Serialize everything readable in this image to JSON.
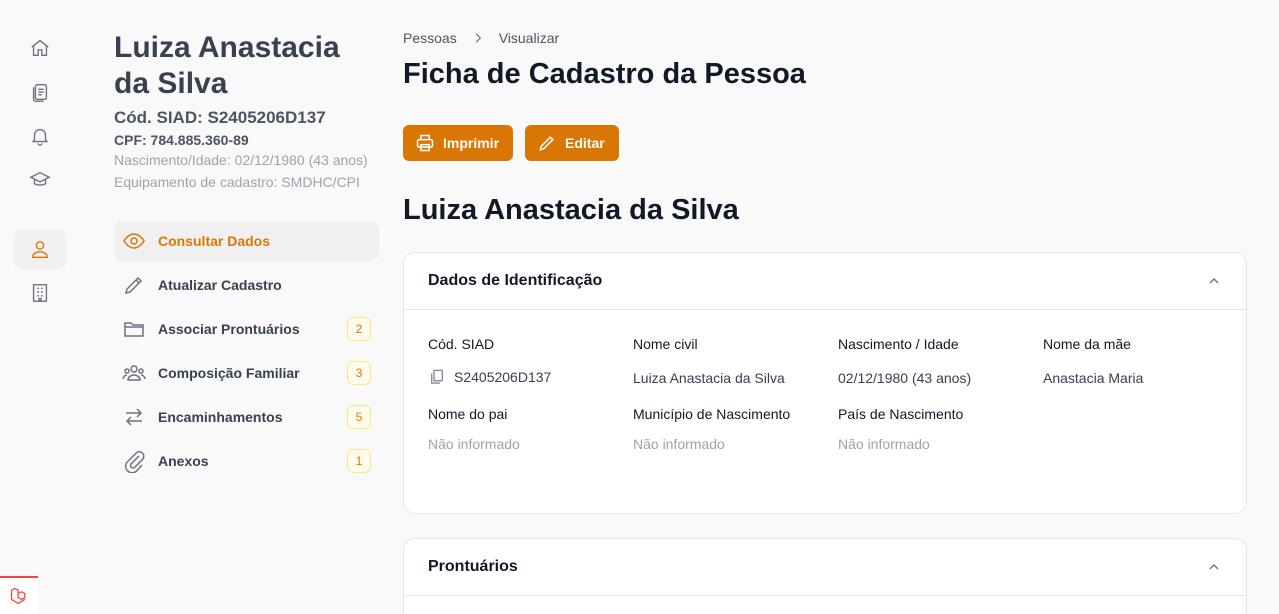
{
  "profile": {
    "name": "Luiza Anastacia da Silva",
    "siad": "Cód. SIAD: S2405206D137",
    "cpf": "CPF: 784.885.360-89",
    "birth": "Nascimento/Idade: 02/12/1980 (43 anos)",
    "equipment": "Equipamento de cadastro: SMDHC/CPI"
  },
  "rail": {
    "items": [
      "home-icon",
      "clipboard-icon",
      "bell-icon",
      "graduation-cap-icon",
      "user-icon",
      "building-icon"
    ],
    "active": "user-icon"
  },
  "menu": {
    "items": [
      {
        "label": "Consultar Dados",
        "icon": "eye-icon",
        "badge": ""
      },
      {
        "label": "Atualizar Cadastro",
        "icon": "pencil-icon",
        "badge": ""
      },
      {
        "label": "Associar Prontuários",
        "icon": "folder-icon",
        "badge": "2"
      },
      {
        "label": "Composição Familiar",
        "icon": "users-icon",
        "badge": "3"
      },
      {
        "label": "Encaminhamentos",
        "icon": "arrows-icon",
        "badge": "5"
      },
      {
        "label": "Anexos",
        "icon": "paperclip-icon",
        "badge": "1"
      }
    ]
  },
  "breadcrumb": {
    "items": [
      "Pessoas",
      "Visualizar"
    ]
  },
  "page": {
    "title": "Ficha de Cadastro da Pessoa",
    "print_label": "Imprimir",
    "edit_label": "Editar",
    "person_heading": "Luiza Anastacia da Silva"
  },
  "identification": {
    "title": "Dados de Identificação",
    "fields": [
      {
        "label": "Cód. SIAD",
        "value": "S2405206D137"
      },
      {
        "label": "Nome civil",
        "value": "Luiza Anastacia da Silva"
      },
      {
        "label": "Nascimento / Idade",
        "value": "02/12/1980 (43 anos)"
      },
      {
        "label": "Nome da mãe",
        "value": "Anastacia Maria"
      },
      {
        "label": "Nome do pai",
        "value": "Não informado"
      },
      {
        "label": "Município de Nascimento",
        "value": "Não informado"
      },
      {
        "label": "País de Nascimento",
        "value": "Não informado"
      }
    ]
  },
  "records": {
    "title": "Prontuários"
  },
  "colors": {
    "accent": "#d97706",
    "background": "#f9f9f9",
    "border": "#e5e7eb"
  }
}
